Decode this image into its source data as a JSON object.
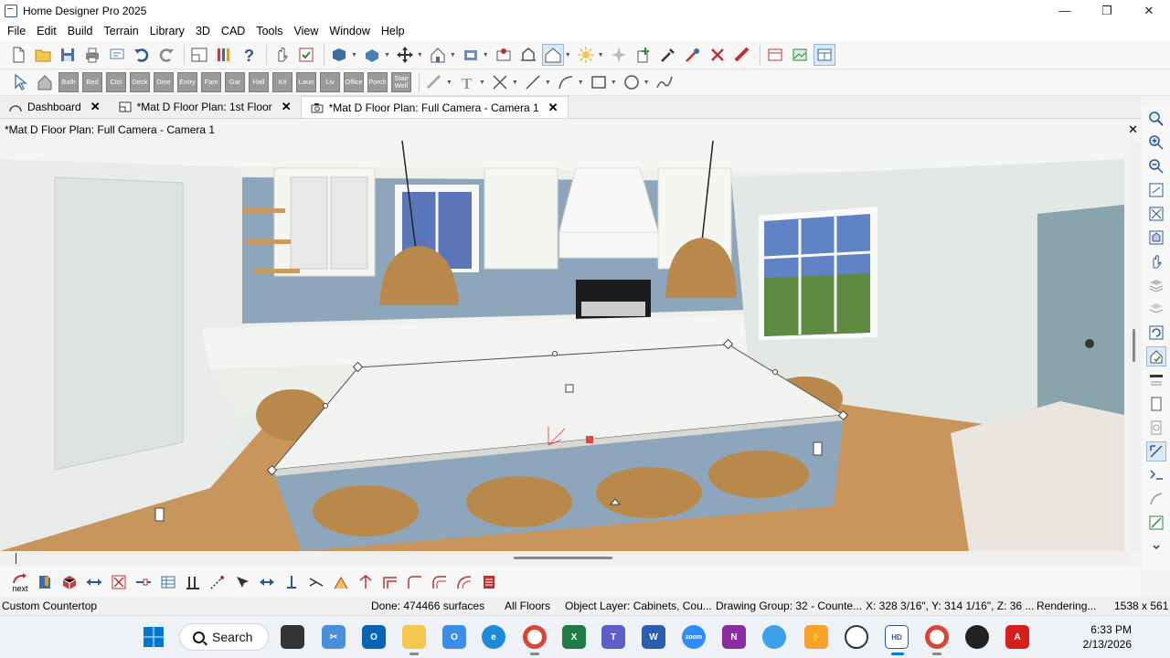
{
  "window": {
    "title": "Home Designer Pro 2025",
    "controls": [
      "—",
      "❐",
      "✕"
    ]
  },
  "menu": [
    "File",
    "Edit",
    "Build",
    "Terrain",
    "Library",
    "3D",
    "CAD",
    "Tools",
    "View",
    "Window",
    "Help"
  ],
  "room_buttons": [
    "Bath",
    "Bed",
    "Clst",
    "Deck",
    "Dine",
    "Entry",
    "Fam",
    "Gar",
    "Hall",
    "Kit",
    "Laun",
    "Liv",
    "Office",
    "Porch",
    "Stair Well"
  ],
  "tabs": [
    {
      "label": "Dashboard",
      "close": "✕"
    },
    {
      "label": "*Mat D Floor Plan: 1st Floor",
      "close": "✕"
    },
    {
      "label": "*Mat D Floor Plan: Full Camera - Camera 1",
      "close": "✕"
    }
  ],
  "doc": {
    "title": "*Mat D Floor Plan: Full Camera - Camera 1",
    "close": "✕"
  },
  "bottom_tool": {
    "next_label": "next"
  },
  "status": {
    "object": "Custom Countertop",
    "done": "Done:  474466 surfaces",
    "floors": "All Floors",
    "layer": "Object Layer: Cabinets, Cou...",
    "group": "Drawing Group: 32 - Counte...",
    "coords": "X: 328 3/16\", Y: 314 1/16\", Z: 36 ...",
    "state": "Rendering...",
    "size": "1538 x 561"
  },
  "taskbar": {
    "search": "Search",
    "time": "6:33 PM",
    "date": "2/13/2026"
  },
  "colors": {
    "accent": "#0078d4",
    "island": "#f2f2f0",
    "floor": "#c8955c",
    "backsplash": "#8ea6bb"
  }
}
